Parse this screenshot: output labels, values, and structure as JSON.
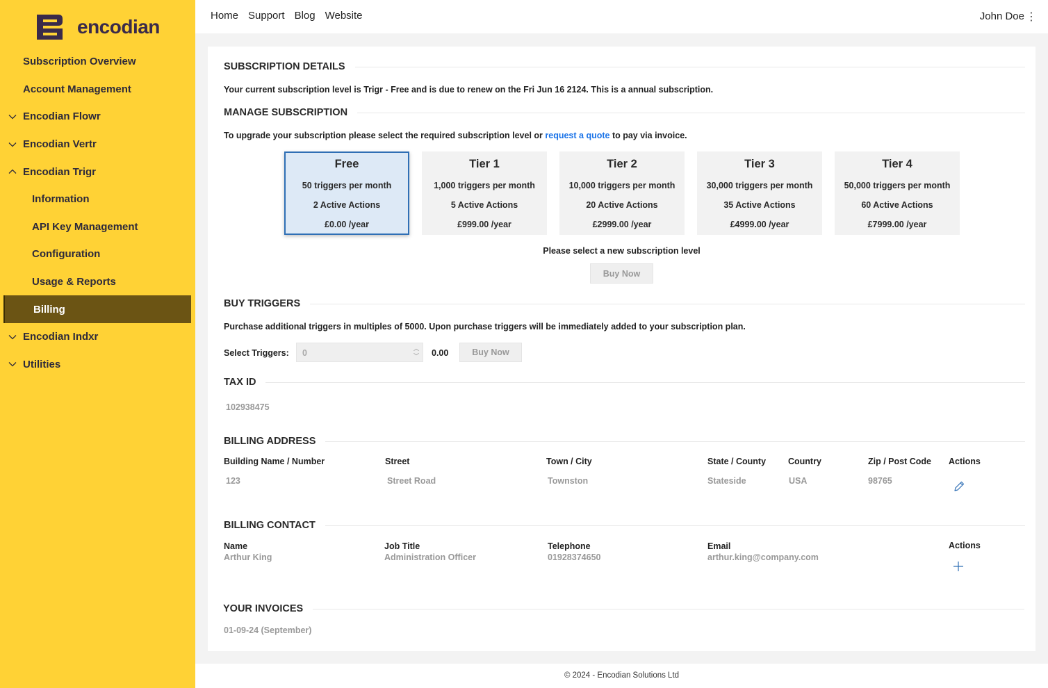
{
  "brand": {
    "name": "encodian"
  },
  "sidebar": {
    "items": [
      {
        "label": "Subscription Overview",
        "level": "top"
      },
      {
        "label": "Account Management",
        "level": "top"
      },
      {
        "label": "Encodian Flowr",
        "level": "top",
        "chevron": "down"
      },
      {
        "label": "Encodian Vertr",
        "level": "top",
        "chevron": "down"
      },
      {
        "label": "Encodian Trigr",
        "level": "top",
        "chevron": "up"
      },
      {
        "label": "Information",
        "level": "sub"
      },
      {
        "label": "API Key Management",
        "level": "sub"
      },
      {
        "label": "Configuration",
        "level": "sub"
      },
      {
        "label": "Usage & Reports",
        "level": "sub"
      },
      {
        "label": "Billing",
        "level": "sub",
        "active": true
      },
      {
        "label": "Encodian Indxr",
        "level": "top",
        "chevron": "down"
      },
      {
        "label": "Utilities",
        "level": "top",
        "chevron": "down"
      }
    ]
  },
  "topbar": {
    "links": [
      "Home",
      "Support",
      "Blog",
      "Website"
    ],
    "user": "John Doe"
  },
  "subscription": {
    "title": "SUBSCRIPTION DETAILS",
    "text": "Your current subscription level is Trigr - Free and is due to renew on the Fri Jun 16 2124. This is a annual subscription."
  },
  "manage": {
    "title": "MANAGE SUBSCRIPTION",
    "text_before": "To upgrade your subscription please select the required subscription level or ",
    "link": "request a quote",
    "text_after": " to pay via invoice.",
    "tiers": [
      {
        "name": "Free",
        "triggers": "50 triggers per month",
        "actions": "2 Active Actions",
        "price": "£0.00 /year",
        "selected": true
      },
      {
        "name": "Tier 1",
        "triggers": "1,000 triggers per month",
        "actions": "5 Active Actions",
        "price": "£999.00 /year"
      },
      {
        "name": "Tier 2",
        "triggers": "10,000 triggers per month",
        "actions": "20 Active Actions",
        "price": "£2999.00 /year"
      },
      {
        "name": "Tier 3",
        "triggers": "30,000 triggers per month",
        "actions": "35 Active Actions",
        "price": "£4999.00 /year"
      },
      {
        "name": "Tier 4",
        "triggers": "50,000 triggers per month",
        "actions": "60 Active Actions",
        "price": "£7999.00 /year"
      }
    ],
    "prompt": "Please select a new subscription level",
    "buy_label": "Buy Now"
  },
  "triggers": {
    "title": "BUY TRIGGERS",
    "text": "Purchase additional triggers in multiples of 5000. Upon purchase triggers will be immediately added to your subscription plan.",
    "select_label": "Select Triggers:",
    "input_value": "0",
    "total": "0.00",
    "buy_label": "Buy Now"
  },
  "tax": {
    "title": "TAX ID",
    "value": "102938475"
  },
  "address": {
    "title": "BILLING ADDRESS",
    "headers": [
      "Building Name / Number",
      "Street",
      "Town / City",
      "State / County",
      "Country",
      "Zip / Post Code",
      "Actions"
    ],
    "values": [
      "123",
      "Street Road",
      "Townston",
      "Stateside",
      "USA",
      "98765"
    ]
  },
  "contact": {
    "title": "BILLING CONTACT",
    "headers": [
      "Name",
      "Job Title",
      "Telephone",
      "Email",
      "Actions"
    ],
    "values": [
      "Arthur King",
      "Administration Officer",
      "01928374650",
      "arthur.king@company.com"
    ]
  },
  "invoices": {
    "title": "YOUR INVOICES",
    "items": [
      "01-09-24 (September)"
    ]
  },
  "footer": {
    "text": "© 2024 - Encodian Solutions Ltd"
  },
  "colors": {
    "sidebar": "#ffd235",
    "active": "#6b5414",
    "link": "#1a73e8",
    "selected_border": "#2f6fb5"
  }
}
